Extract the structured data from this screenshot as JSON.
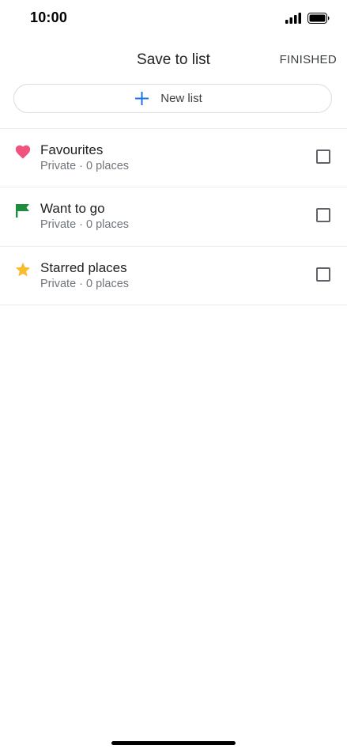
{
  "status_bar": {
    "time": "10:00",
    "signal_icon": "cellular-signal-icon",
    "battery_icon": "battery-full-icon"
  },
  "header": {
    "title": "Save to list",
    "finished_label": "FINISHED"
  },
  "new_list": {
    "label": "New list",
    "icon": "plus-icon",
    "icon_color": "#1a73e8"
  },
  "lists": [
    {
      "title": "Favourites",
      "subtitle": "Private · 0 places",
      "icon": "heart-icon",
      "icon_color": "#f0537e",
      "checked": false
    },
    {
      "title": "Want to go",
      "subtitle": "Private · 0 places",
      "icon": "flag-icon",
      "icon_color": "#1e8e3e",
      "checked": false
    },
    {
      "title": "Starred places",
      "subtitle": "Private · 0 places",
      "icon": "star-icon",
      "icon_color": "#f9bc2c",
      "checked": false
    }
  ]
}
